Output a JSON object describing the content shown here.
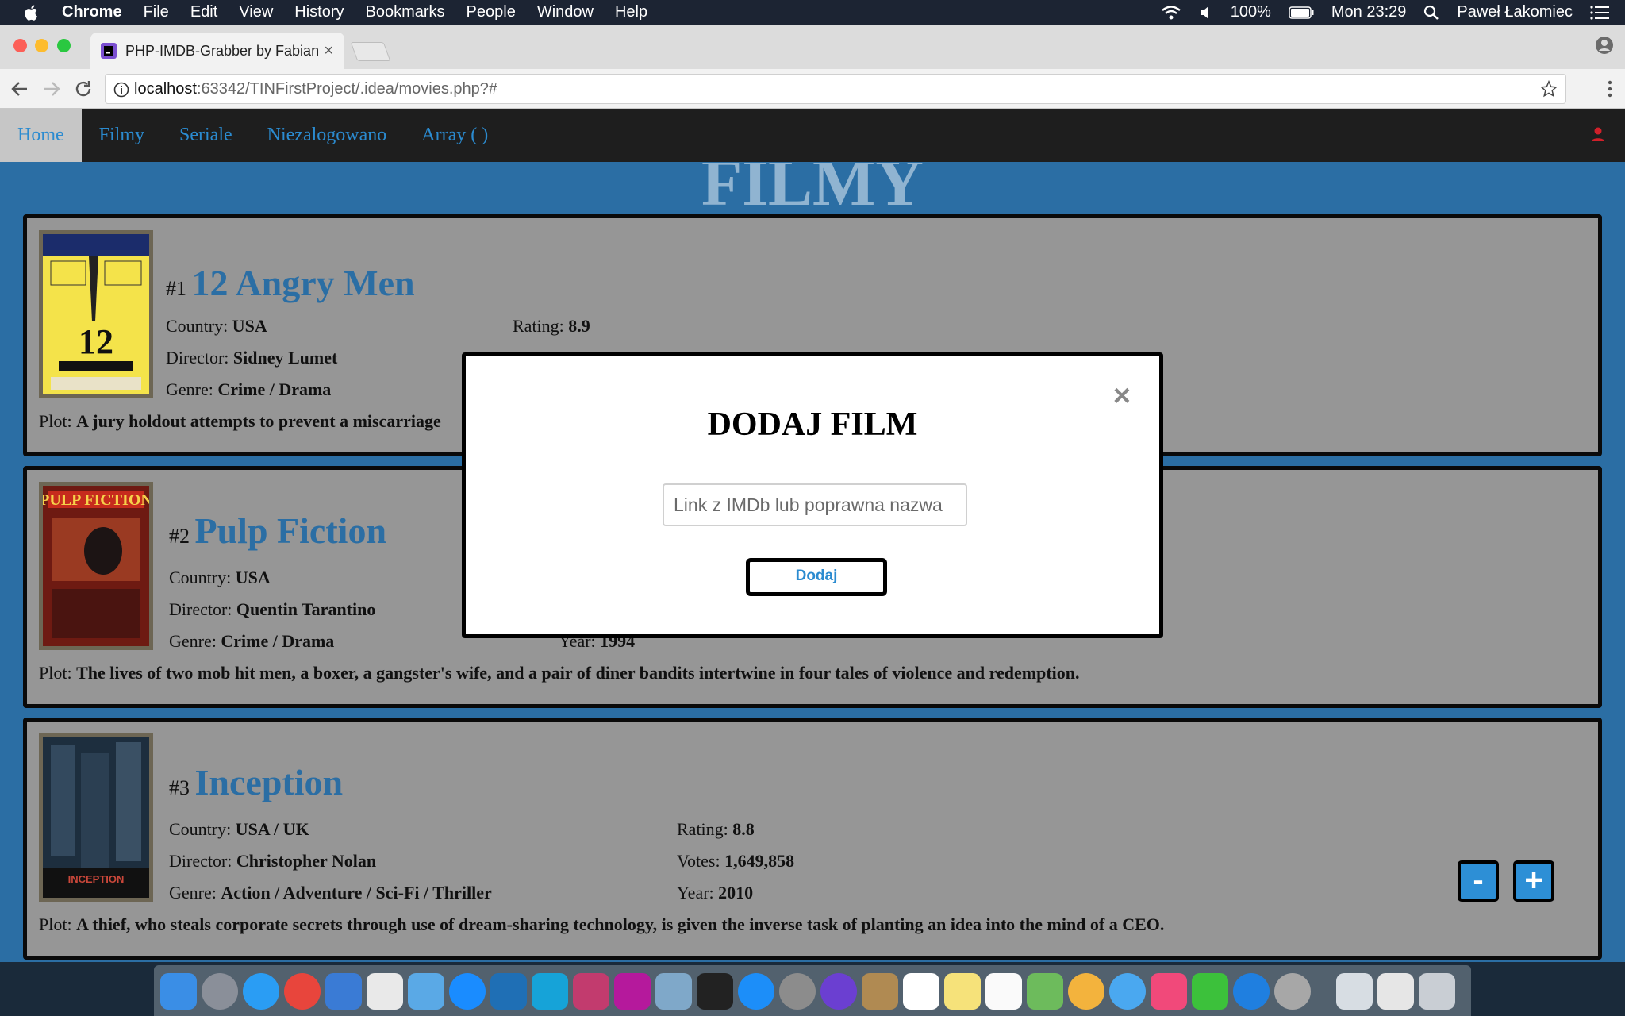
{
  "menubar": {
    "app": "Chrome",
    "items": [
      "File",
      "Edit",
      "View",
      "History",
      "Bookmarks",
      "People",
      "Window",
      "Help"
    ],
    "battery": "100%",
    "clock": "Mon 23:29",
    "user": "Paweł Łakomiec"
  },
  "browser": {
    "tab_title": "PHP-IMDB-Grabber by Fabian",
    "tab_close": "×",
    "url_host": "localhost",
    "url_path": ":63342/TINFirstProject/.idea/movies.php?#"
  },
  "nav": {
    "items": [
      "Home",
      "Filmy",
      "Seriale",
      "Niezalogowano",
      "Array ( )"
    ]
  },
  "page_heading": "FILMY",
  "movies": [
    {
      "rank": "#1",
      "title": "12 Angry Men",
      "country_label": "Country:",
      "country": "USA",
      "director_label": "Director:",
      "director": "Sidney Lumet",
      "genre_label": "Genre:",
      "genre": "Crime / Drama",
      "rating_label": "Rating:",
      "rating": "8.9",
      "votes_label": "Votes:",
      "votes": "517,174",
      "plot_label": "Plot:",
      "plot": "A jury holdout attempts to prevent a miscarriage"
    },
    {
      "rank": "#2",
      "title": "Pulp Fiction",
      "country_label": "Country:",
      "country": "USA",
      "director_label": "Director:",
      "director": "Quentin Tarantino",
      "genre_label": "Genre:",
      "genre": "Crime / Drama",
      "year_label": "Year:",
      "year": "1994",
      "plot_label": "Plot:",
      "plot": "The lives of two mob hit men, a boxer, a gangster's wife, and a pair of diner bandits intertwine in four tales of violence and redemption."
    },
    {
      "rank": "#3",
      "title": "Inception",
      "country_label": "Country:",
      "country": "USA / UK",
      "director_label": "Director:",
      "director": "Christopher Nolan",
      "genre_label": "Genre:",
      "genre": "Action / Adventure / Sci-Fi / Thriller",
      "rating_label": "Rating:",
      "rating": "8.8",
      "votes_label": "Votes:",
      "votes": "1,649,858",
      "year_label": "Year:",
      "year": "2010",
      "plot_label": "Plot:",
      "plot": "A thief, who steals corporate secrets through use of dream-sharing technology, is given the inverse task of planting an idea into the mind of a CEO."
    }
  ],
  "controls": {
    "minus": "-",
    "plus": "+"
  },
  "modal": {
    "title": "DODAJ FILM",
    "close": "×",
    "input_placeholder": "Link z IMDb lub poprawna nazwa",
    "button": "Dodaj"
  },
  "colors": {
    "page_bg": "#2b6ea4",
    "nav_bg": "#1e1e1e",
    "link": "#2b8bd0",
    "card_bg": "#969696"
  }
}
